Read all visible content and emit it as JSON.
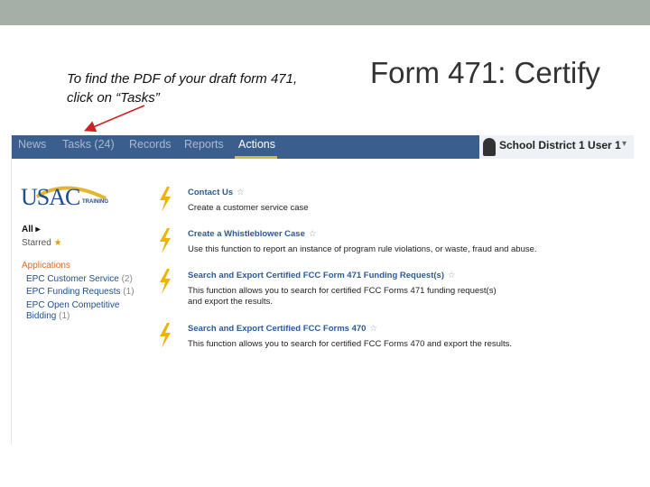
{
  "slide": {
    "note_line1": "To find the PDF of your draft form 471,",
    "note_line2": "click on “Tasks”",
    "title": "Form 471:  Certify"
  },
  "nav": {
    "items": [
      {
        "label": "News"
      },
      {
        "label": "Tasks (24)"
      },
      {
        "label": "Records"
      },
      {
        "label": "Reports"
      },
      {
        "label": "Actions",
        "active": true
      }
    ],
    "user": "School District 1 User 1",
    "caret": "▾"
  },
  "logo": {
    "text": "USAC",
    "sub": "TRAINING"
  },
  "sidebar": {
    "all": "All ▸",
    "starred": "Starred",
    "star_glyph": "★",
    "applications_heading": "Applications",
    "links": [
      {
        "label": "EPC Customer Service",
        "count": "(2)"
      },
      {
        "label": "EPC Funding Requests",
        "count": "(1)"
      },
      {
        "label": "EPC Open Competitive Bidding",
        "count": "(1)"
      }
    ]
  },
  "actions": [
    {
      "title": "Contact Us",
      "desc": "Create a customer service case"
    },
    {
      "title": "Create a Whistleblower Case",
      "desc": "Use this function to report an instance of program rule violations, or waste, fraud and abuse."
    },
    {
      "title": "Search and Export Certified FCC Form 471 Funding Request(s)",
      "desc": "This function allows you to search for certified FCC Forms 471 funding request(s) and export the results."
    },
    {
      "title": "Search and Export Certified FCC Forms 470",
      "desc": "This function allows you to search for certified FCC Forms 470 and export the results."
    }
  ],
  "icons": {
    "action": "lightning-bolt-icon",
    "favorite": "star-outline-icon",
    "arrow": "arrow-annotation"
  },
  "colors": {
    "nav_bg": "#3a5f8f",
    "active_underline": "#d9b844",
    "bolt": "#f0b400",
    "link": "#1f4f8e",
    "accent_orange": "#d86b20",
    "arrow": "#cc2222"
  }
}
